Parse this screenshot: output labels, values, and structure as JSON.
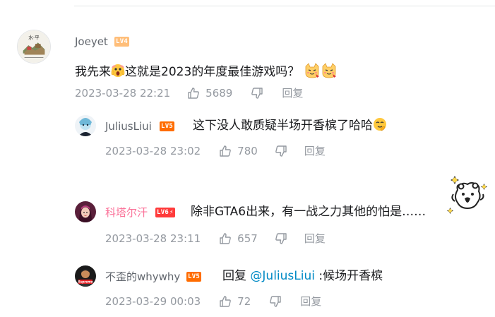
{
  "comments": [
    {
      "username": "Joeyet",
      "level": "LV4",
      "text_before": "我先来",
      "text_after": "这就是2023的年度最佳游戏吗？",
      "date": "2023-03-28 22:21",
      "likes": "5689",
      "reply_label": "回复",
      "avatar_text": "水·平"
    },
    {
      "username": "JuliusLiui",
      "level": "LV5",
      "text": "这下没人敢质疑半场开香槟了哈哈",
      "date": "2023-03-28 23:02",
      "likes": "780",
      "reply_label": "回复"
    },
    {
      "username": "科塔尔汗",
      "level": "LV6",
      "text": "除非GTA6出来，有一战之力其他的怕是……",
      "date": "2023-03-28 23:11",
      "likes": "657",
      "reply_label": "回复"
    },
    {
      "username": "不歪的whywhy",
      "level": "LV5",
      "reply_prefix": "回复 ",
      "mention": "@JuliusLiui",
      "text": " :候场开香槟",
      "date": "2023-03-29 00:03",
      "likes": "72",
      "reply_label": "回复",
      "avatar_text": "Supreme"
    }
  ],
  "colors": {
    "username": "#61666d",
    "username_vip": "#fb7299",
    "meta": "#9499a0",
    "mention": "#008ac5",
    "lv4": "#ffa94d",
    "lv5": "#ff6c00",
    "lv6": "#ff3b3b"
  },
  "icons": [
    "thumbs-up-icon",
    "thumbs-down-icon",
    "scream-emoji",
    "cat-emoji",
    "smirk-emoji",
    "bear-sticker"
  ]
}
